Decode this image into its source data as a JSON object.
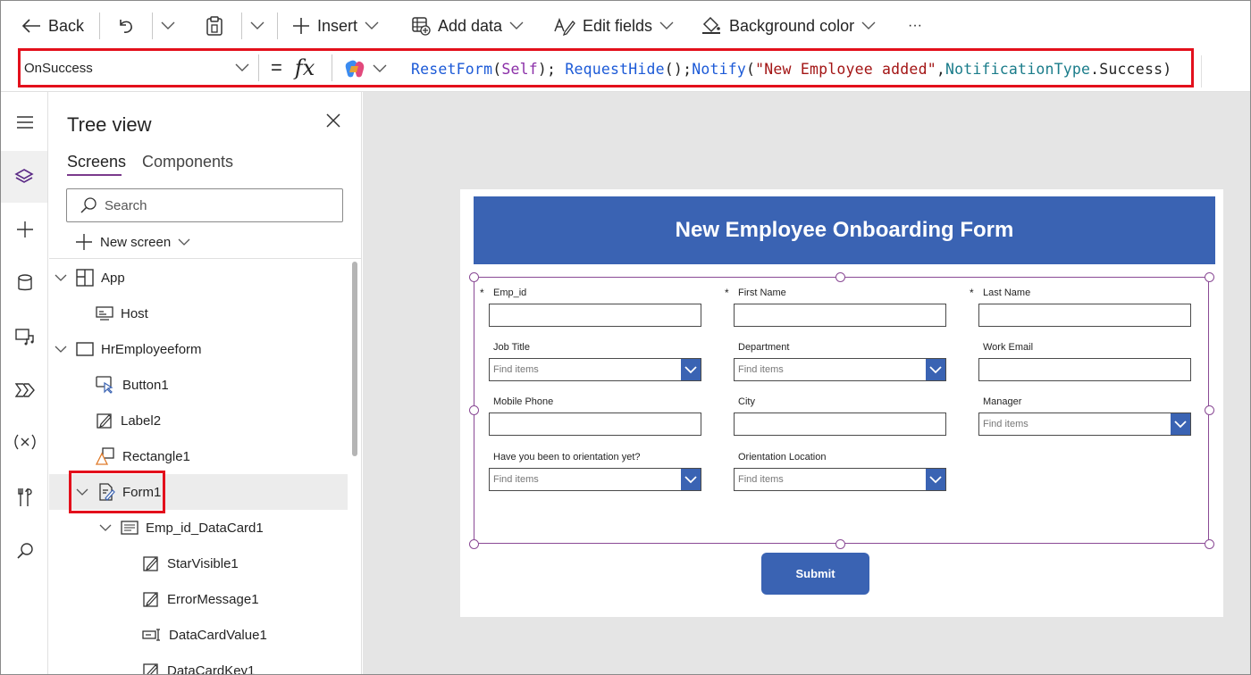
{
  "toolbar": {
    "back_label": "Back",
    "insert_label": "Insert",
    "add_data_label": "Add data",
    "edit_fields_label": "Edit fields",
    "background_color_label": "Background color",
    "more_label": "···"
  },
  "formula_bar": {
    "property": "OnSuccess",
    "equals": "=",
    "fx": "fx",
    "tokens": [
      {
        "text": "ResetForm",
        "kind": "fn"
      },
      {
        "text": "(",
        "kind": "plain"
      },
      {
        "text": "Self",
        "kind": "arg"
      },
      {
        "text": "); ",
        "kind": "plain"
      },
      {
        "text": "RequestHide",
        "kind": "fn"
      },
      {
        "text": "();",
        "kind": "plain"
      },
      {
        "text": "Notify",
        "kind": "fn"
      },
      {
        "text": "(",
        "kind": "plain"
      },
      {
        "text": "\"New Employee added\"",
        "kind": "str"
      },
      {
        "text": ",",
        "kind": "plain"
      },
      {
        "text": "NotificationType",
        "kind": "enum"
      },
      {
        "text": ".Success)",
        "kind": "plain"
      }
    ]
  },
  "tree_view": {
    "title": "Tree view",
    "tabs": {
      "screens": "Screens",
      "components": "Components"
    },
    "search_placeholder": "Search",
    "new_screen_label": "New screen",
    "nodes": {
      "app": "App",
      "host": "Host",
      "screen": "HrEmployeeform",
      "button1": "Button1",
      "label2": "Label2",
      "rectangle1": "Rectangle1",
      "form1": "Form1",
      "datacard": "Emp_id_DataCard1",
      "starvisible": "StarVisible1",
      "errormessage": "ErrorMessage1",
      "datacardvalue": "DataCardValue1",
      "datacardkey": "DataCardKey1"
    }
  },
  "form": {
    "title": "New Employee Onboarding Form",
    "required_mark": "*",
    "dropdown_placeholder": "Find items",
    "fields": {
      "emp_id": "Emp_id",
      "first_name": "First Name",
      "last_name": "Last Name",
      "job_title": "Job Title",
      "department": "Department",
      "work_email": "Work Email",
      "mobile_phone": "Mobile Phone",
      "city": "City",
      "manager": "Manager",
      "orientation": "Have you been to orientation yet?",
      "orientation_location": "Orientation Location"
    },
    "submit_label": "Submit"
  },
  "colors": {
    "accent": "#3a63b3",
    "highlight": "#e3101c",
    "selection": "#8a4a95"
  }
}
